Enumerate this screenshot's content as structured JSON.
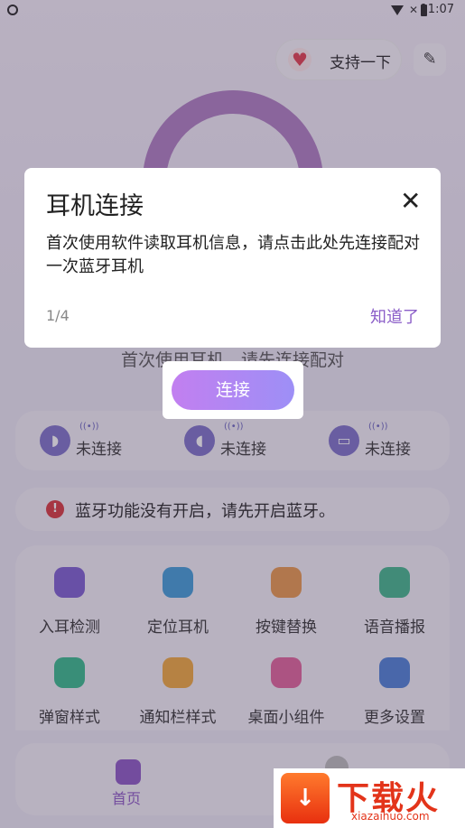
{
  "status_bar": {
    "time": "11:07"
  },
  "header": {
    "support_label": "支持一下"
  },
  "main": {
    "first_use_text": "首次使用耳机，请先连接配对",
    "connect_label": "连接",
    "devices": [
      {
        "tag": "((•))",
        "status": "未连接"
      },
      {
        "tag": "((•))",
        "status": "未连接"
      },
      {
        "tag": "((•))",
        "status": "未连接"
      }
    ],
    "alert_text": "蓝牙功能没有开启，请先开启蓝牙。",
    "features": [
      {
        "label": "入耳检测",
        "color": "#7a5bd1"
      },
      {
        "label": "定位耳机",
        "color": "#3e9bd8"
      },
      {
        "label": "按键替换",
        "color": "#e8964a"
      },
      {
        "label": "语音播报",
        "color": "#3fb58a"
      },
      {
        "label": "弹窗样式",
        "color": "#32b98a"
      },
      {
        "label": "通知栏样式",
        "color": "#f0a83a"
      },
      {
        "label": "桌面小组件",
        "color": "#e1609a"
      },
      {
        "label": "更多设置",
        "color": "#4b7fd6"
      }
    ]
  },
  "tabbar": {
    "home_label": "首页"
  },
  "dialog": {
    "title": "耳机连接",
    "message": "首次使用软件读取耳机信息，请点击此处先连接配对一次蓝牙耳机",
    "step": "1/4",
    "ok_label": "知道了"
  },
  "watermark": {
    "name": "下载火",
    "url": "xiazaihuo.com"
  }
}
